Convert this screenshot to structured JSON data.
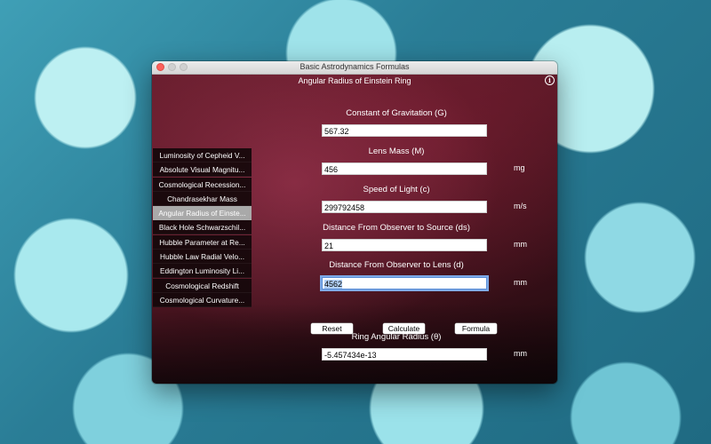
{
  "window": {
    "title": "Basic Astrodynamics Formulas"
  },
  "main": {
    "heading": "Angular Radius of Einstein Ring",
    "info_icon": "i"
  },
  "sidebar": {
    "items": [
      {
        "label": "Luminosity of Cepheid V..."
      },
      {
        "label": "Absolute Visual Magnitu..."
      },
      {
        "label": "Cosmological Recession..."
      },
      {
        "label": "Chandrasekhar Mass"
      },
      {
        "label": "Angular Radius of Einste..."
      },
      {
        "label": "Black Hole Schwarzschil..."
      },
      {
        "label": "Hubble Parameter at Re..."
      },
      {
        "label": "Hubble Law Radial Velo..."
      },
      {
        "label": "Eddington Luminosity Li..."
      },
      {
        "label": "Cosmological Redshift"
      },
      {
        "label": "Cosmological Curvature..."
      }
    ],
    "selected_index": 4
  },
  "fields": [
    {
      "label": "Constant of Gravitation (G)",
      "value": "567.32",
      "unit": ""
    },
    {
      "label": "Lens Mass (M)",
      "value": "456",
      "unit": "mg"
    },
    {
      "label": "Speed of Light (c)",
      "value": "299792458",
      "unit": "m/s"
    },
    {
      "label": "Distance From Observer to Source (ds)",
      "value": "21",
      "unit": "mm"
    },
    {
      "label": "Distance From Observer to Lens (d)",
      "value": "4562",
      "unit": "mm"
    }
  ],
  "buttons": {
    "reset": "Reset",
    "calculate": "Calculate",
    "formula": "Formula"
  },
  "result": {
    "label": "Ring Angular Radius (θ)",
    "value": "-5.457434e-13",
    "unit": "mm"
  }
}
